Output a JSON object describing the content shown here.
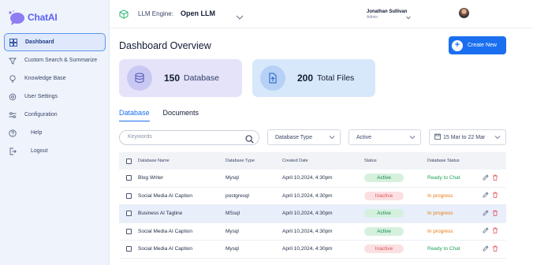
{
  "app": {
    "logo_text": "ChatAI"
  },
  "sidebar": {
    "items": [
      {
        "label": "Dashboard",
        "icon": "dashboard-icon"
      },
      {
        "label": "Custom Search & Summarize",
        "icon": "search-summarize-icon"
      },
      {
        "label": "Knowledge Base",
        "icon": "lightbulb-icon"
      },
      {
        "label": "User Settings",
        "icon": "gear-icon"
      },
      {
        "label": "Configuration",
        "icon": "sliders-icon"
      },
      {
        "label": "Help",
        "icon": "help-icon"
      },
      {
        "label": "Logout",
        "icon": "logout-icon"
      }
    ]
  },
  "header": {
    "engine_label": "LLM Engine:",
    "engine_value": "Open LLM",
    "user_name": "Jonathan Sullivan",
    "user_role": "Admin"
  },
  "main": {
    "title": "Dashboard Overview",
    "create_label": "Create New",
    "stats": [
      {
        "value": "150",
        "label": "Database",
        "icon": "database-icon"
      },
      {
        "value": "200",
        "label": "Total Files",
        "icon": "files-icon"
      }
    ],
    "tabs": [
      {
        "label": "Database"
      },
      {
        "label": "Documents"
      }
    ],
    "filters": {
      "search_placeholder": "Keywords",
      "type": "Database Type",
      "status": "Active",
      "date": "15 Mar to 22 Mar"
    },
    "table": {
      "headers": [
        "Database Name",
        "Database Type",
        "Created Date",
        "Status",
        "Database Status"
      ],
      "rows": [
        {
          "name": "Blog Writer",
          "type": "Mysql",
          "date": "April 10,2024, 4:30pm",
          "status": "Active",
          "db_status": "Ready to Chat"
        },
        {
          "name": "Social Media AI Caption",
          "type": "postgresql",
          "date": "April 10,2024, 4:30pm",
          "status": "Inactive",
          "db_status": "In progress"
        },
        {
          "name": "Business AI Tagline",
          "type": "MSsql",
          "date": "April 10,2024, 4:30pm",
          "status": "Active",
          "db_status": "In progress"
        },
        {
          "name": "Social Media AI Caption",
          "type": "Mysql",
          "date": "April 10,2024, 4:30pm",
          "status": "Active",
          "db_status": "In progress"
        },
        {
          "name": "Social Media AI Caption",
          "type": "Mysql",
          "date": "April 10,2024, 4:30pm",
          "status": "Inactive",
          "db_status": "Ready to Chat"
        }
      ]
    }
  },
  "colors": {
    "accent": "#1a6ff0",
    "active_green": "#1b8a47",
    "inactive_red": "#e0525c",
    "progress_orange": "#e57c12"
  }
}
